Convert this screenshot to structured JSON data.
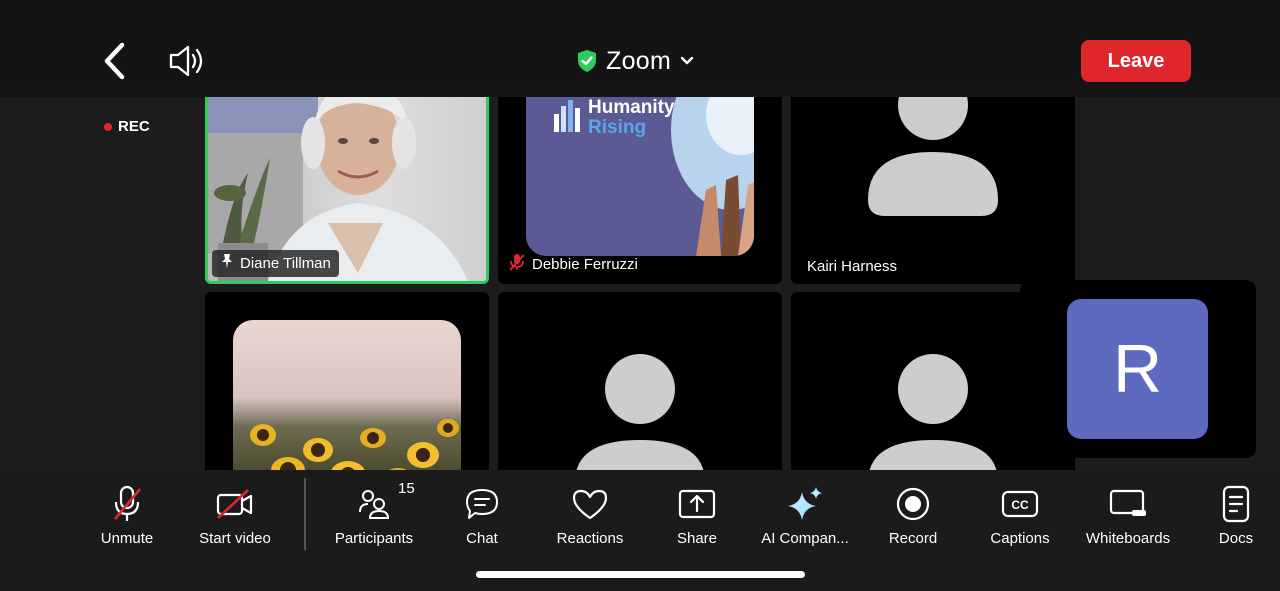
{
  "header": {
    "title": "Zoom",
    "leave_label": "Leave",
    "rec_label": "REC"
  },
  "tiles": [
    {
      "name": "Diane Tillman",
      "muted": false,
      "active": true,
      "pinned": true
    },
    {
      "name": "Debbie Ferruzzi",
      "muted": true,
      "background_text_1": "Humanity",
      "background_text_2": "Rising"
    },
    {
      "name": "Kairi Harness",
      "muted": false
    },
    {
      "name": "",
      "muted": false
    },
    {
      "name": "",
      "muted": false
    },
    {
      "name": "",
      "muted": true
    }
  ],
  "self_view": {
    "initial": "R"
  },
  "toolbar": {
    "participants_count": "15",
    "items": [
      {
        "label": "Unmute",
        "icon": "mic-off-icon"
      },
      {
        "label": "Start video",
        "icon": "video-off-icon"
      },
      {
        "label": "Participants",
        "icon": "participants-icon"
      },
      {
        "label": "Chat",
        "icon": "chat-icon"
      },
      {
        "label": "Reactions",
        "icon": "heart-icon"
      },
      {
        "label": "Share",
        "icon": "share-icon"
      },
      {
        "label": "AI Compan...",
        "icon": "sparkle-icon"
      },
      {
        "label": "Record",
        "icon": "record-icon"
      },
      {
        "label": "Captions",
        "icon": "captions-icon"
      },
      {
        "label": "Whiteboards",
        "icon": "whiteboard-icon"
      },
      {
        "label": "Docs",
        "icon": "docs-icon"
      }
    ]
  },
  "colors": {
    "leave": "#e0262d",
    "active_border": "#2fcc5a",
    "avatar_bg": "#5e6ac0",
    "muted": "#e0262d",
    "shield": "#2fcc5a"
  }
}
